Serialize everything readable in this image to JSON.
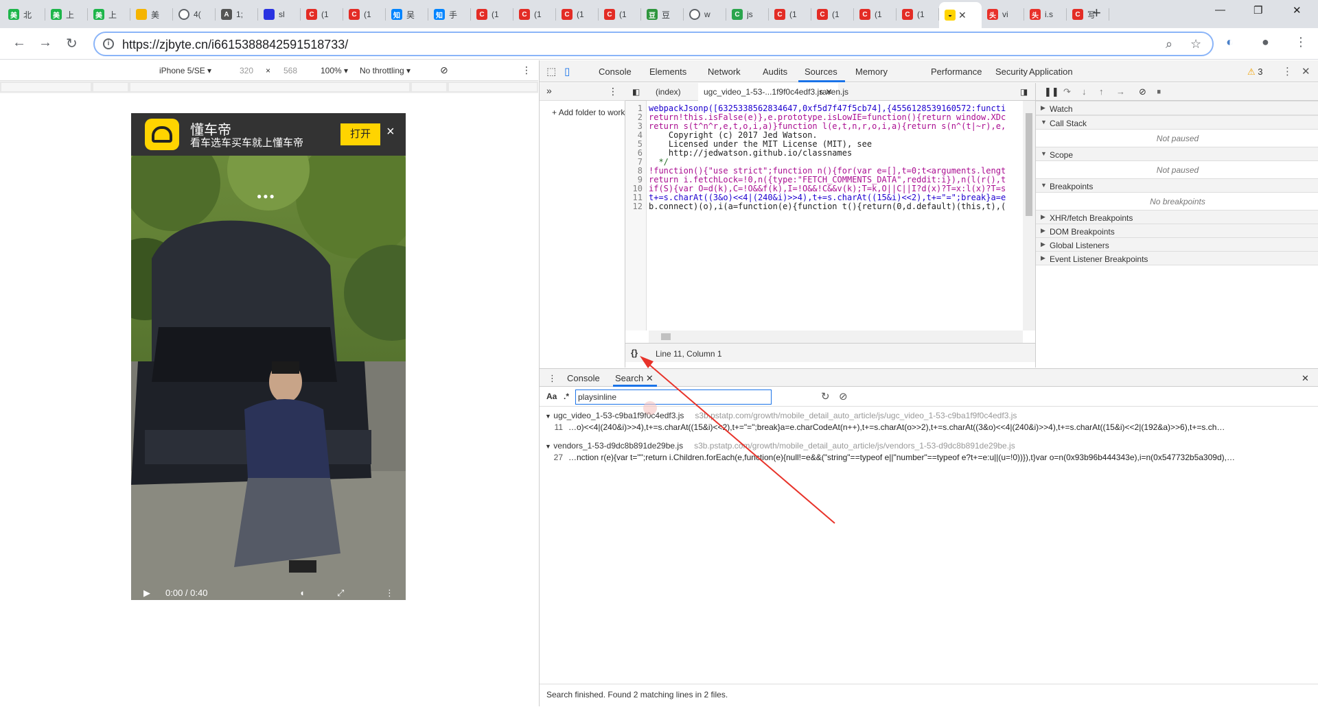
{
  "browser": {
    "tabs": [
      {
        "icon": "meituan-icon",
        "color": "#1db54a",
        "glyph": "美",
        "title": "北"
      },
      {
        "icon": "meituan-icon",
        "color": "#1db54a",
        "glyph": "美",
        "title": "上"
      },
      {
        "icon": "meituan-icon",
        "color": "#1db54a",
        "glyph": "美",
        "title": "上"
      },
      {
        "icon": "folder-icon",
        "color": "#f5b400",
        "glyph": "",
        "title": "美"
      },
      {
        "icon": "globe-icon",
        "color": "#5f6368",
        "glyph": "",
        "title": "4("
      },
      {
        "icon": "translate-icon",
        "color": "#555555",
        "glyph": "A",
        "title": "1;"
      },
      {
        "icon": "baidu-icon",
        "color": "#2932e1",
        "glyph": "",
        "title": "sl"
      },
      {
        "icon": "csdn-icon",
        "color": "#e32c25",
        "glyph": "C",
        "title": "(1"
      },
      {
        "icon": "csdn-icon",
        "color": "#e32c25",
        "glyph": "C",
        "title": "(1"
      },
      {
        "icon": "zhihu-icon",
        "color": "#0084ff",
        "glyph": "知",
        "title": "吴"
      },
      {
        "icon": "zhihu-icon",
        "color": "#0084ff",
        "glyph": "知",
        "title": "手"
      },
      {
        "icon": "csdn-icon",
        "color": "#e32c25",
        "glyph": "C",
        "title": "(1"
      },
      {
        "icon": "csdn-icon",
        "color": "#e32c25",
        "glyph": "C",
        "title": "(1"
      },
      {
        "icon": "csdn-icon",
        "color": "#e32c25",
        "glyph": "C",
        "title": "(1"
      },
      {
        "icon": "csdn-icon",
        "color": "#e32c25",
        "glyph": "C",
        "title": "(1"
      },
      {
        "icon": "douban-icon",
        "color": "#2e963d",
        "glyph": "豆",
        "title": "豆"
      },
      {
        "icon": "globe-icon",
        "color": "#5f6368",
        "glyph": "",
        "title": "w"
      },
      {
        "icon": "green-c-icon",
        "color": "#2aa54d",
        "glyph": "C",
        "title": "js"
      },
      {
        "icon": "csdn-icon",
        "color": "#e32c25",
        "glyph": "C",
        "title": "(1"
      },
      {
        "icon": "csdn-icon",
        "color": "#e32c25",
        "glyph": "C",
        "title": "(1"
      },
      {
        "icon": "csdn-icon",
        "color": "#e32c25",
        "glyph": "C",
        "title": "(1"
      },
      {
        "icon": "csdn-icon",
        "color": "#e32c25",
        "glyph": "C",
        "title": "(1"
      },
      {
        "icon": "dongchedi-icon",
        "color": "#ffd400",
        "glyph": "",
        "title": "",
        "active": true
      },
      {
        "icon": "toutiao-icon",
        "color": "#e8312a",
        "glyph": "头",
        "title": "vi"
      },
      {
        "icon": "toutiao-icon",
        "color": "#e8312a",
        "glyph": "头",
        "title": "i.s"
      },
      {
        "icon": "csdn-icon",
        "color": "#e32c25",
        "glyph": "C",
        "title": "写"
      }
    ],
    "url": "https://zjbyte.cn/i6615388842591518733/"
  },
  "device_toolbar": {
    "device": "iPhone 5/SE",
    "width": "320",
    "times": "×",
    "height": "568",
    "zoom": "100%",
    "throttling": "No throttling"
  },
  "phone_page": {
    "app_name": "懂车帝",
    "slogan": "看车选车买车就上懂车帝",
    "open_button": "打开",
    "close": "×",
    "controls_time": "0:00 / 0:40"
  },
  "devtools": {
    "tabs": [
      "Console",
      "Elements",
      "Network",
      "Audits",
      "Sources",
      "Memory",
      "Performance",
      "Security",
      "Application"
    ],
    "active_tab": "Sources",
    "warnings": "3",
    "navigator": {
      "add_folder": "Add folder to workspace"
    },
    "editor_tabs": [
      "(index)",
      "ugc_video_1-53-...1f9f0c4edf3.js",
      "raven.js"
    ],
    "line_numbers": [
      "1",
      "2",
      "3",
      "4",
      "5",
      "6",
      "7",
      "8",
      "9",
      "10",
      "11",
      "12"
    ],
    "code_lines": [
      "webpackJsonp([6325338562834647,0xf5d7f47f5cb74],{4556128539160572:functi",
      "return!this.isFalse(e)},e.prototype.isLowIE=function(){return window.XDc",
      "return s(t^n^r,e,t,o,i,a)}function l(e,t,n,r,o,i,a){return s(n^(t|~r),e,",
      "    Copyright (c) 2017 Jed Watson.",
      "    Licensed under the MIT License (MIT), see",
      "    http://jedwatson.github.io/classnames",
      "  */",
      "!function(){\"use strict\";function n(){for(var e=[],t=0;t<arguments.lengt",
      "return i.fetchLock=!0,n({type:\"FETCH_COMMENTS_DATA\",reddit:i}),n(l(r(),t",
      "if(S){var O=d(k),C=!O&&f(k),I=!O&&!C&&v(k);T=k,O||C||I?d(x)?T=x:l(x)?T=s",
      "t+=s.charAt((3&o)<<4|(240&i)>>4),t+=s.charAt((15&i)<<2),t+=\"=\";break}a=e",
      "b.connect)(o),i(a=function(e){function t(){return(0,d.default)(this,t),("
    ],
    "status": "Line 11, Column 1",
    "debugger": {
      "watch": "Watch",
      "call_stack": "Call Stack",
      "call_stack_empty": "Not paused",
      "scope": "Scope",
      "scope_empty": "Not paused",
      "breakpoints": "Breakpoints",
      "breakpoints_empty": "No breakpoints",
      "xhr": "XHR/fetch Breakpoints",
      "dom": "DOM Breakpoints",
      "global": "Global Listeners",
      "event": "Event Listener Breakpoints"
    },
    "drawer": {
      "tabs": [
        "Console",
        "Search"
      ],
      "case_toggle": "Aa",
      "regex_toggle": ".*",
      "query": "playsinline",
      "results": [
        {
          "file": "ugc_video_1-53-c9ba1f9f0c4edf3.js",
          "path": "s3b.pstatp.com/growth/mobile_detail_auto_article/js/ugc_video_1-53-c9ba1f9f0c4edf3.js",
          "line": "11",
          "text": "…o)<<4|(240&i)>>4),t+=s.charAt((15&i)<<2),t+=\"=\";break}a=e.charCodeAt(n++),t+=s.charAt(o>>2),t+=s.charAt((3&o)<<4|(240&i)>>4),t+=s.charAt((15&i)<<2|(192&a)>>6),t+=s.ch…"
        },
        {
          "file": "vendors_1-53-d9dc8b891de29be.js",
          "path": "s3b.pstatp.com/growth/mobile_detail_auto_article/js/vendors_1-53-d9dc8b891de29be.js",
          "line": "27",
          "text": "…nction r(e){var t=\"\";return i.Children.forEach(e,function(e){null!=e&&(\"string\"==typeof e||\"number\"==typeof e?t+=e:u||(u=!0))}),t}var o=n(0x93b96b444343e),i=n(0x547732b5a309d),…"
        }
      ],
      "status": "Search finished.  Found 2 matching lines in 2 files."
    }
  },
  "colors": {
    "accent": "#1a73e8",
    "annotation_arrow": "#e8332a",
    "brand_yellow": "#ffd400"
  }
}
